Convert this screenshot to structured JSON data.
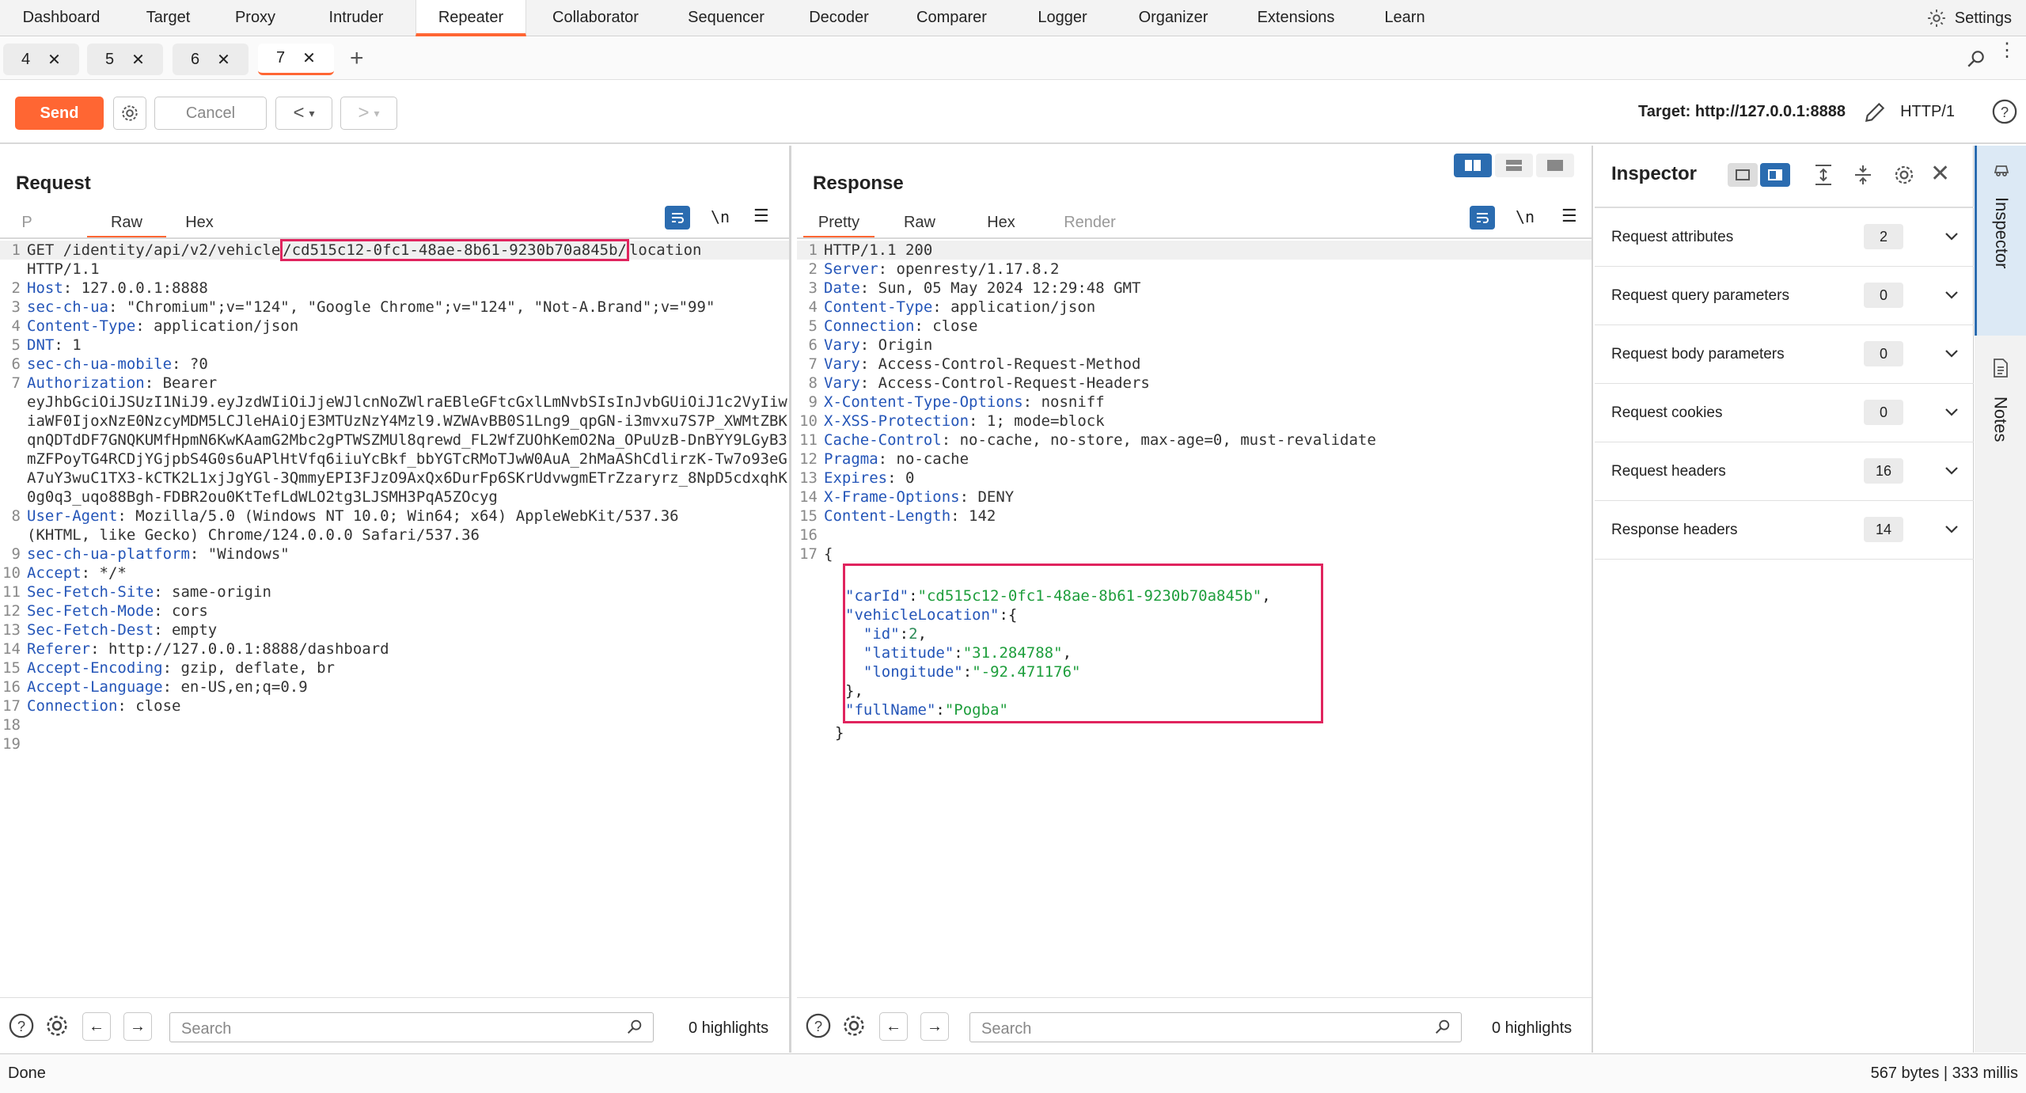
{
  "topnav": {
    "tabs": [
      "Dashboard",
      "Target",
      "Proxy",
      "Intruder",
      "Repeater",
      "Collaborator",
      "Sequencer",
      "Decoder",
      "Comparer",
      "Logger",
      "Organizer",
      "Extensions",
      "Learn"
    ],
    "active": "Repeater",
    "settings_label": "Settings"
  },
  "repeater_tabs": [
    "4",
    "5",
    "6",
    "7"
  ],
  "active_tab": "7",
  "toolbar": {
    "send_label": "Send",
    "cancel_label": "Cancel",
    "target_label": "Target: http://127.0.0.1:8888",
    "protocol_label": "HTTP/1"
  },
  "request": {
    "title": "Request",
    "view_tabs": [
      "P",
      "Raw",
      "Hex"
    ],
    "active_view": "Raw",
    "wrap_label": "\\n",
    "lines": [
      {
        "n": "1",
        "pre": "GET /identity/api/v2/vehicle",
        "hl": "/cd515c12-0fc1-48ae-8b61-9230b70a845b/",
        "post": "location"
      },
      {
        "n": "",
        "text": "HTTP/1.1"
      },
      {
        "n": "2",
        "key": "Host",
        "val": " 127.0.0.1:8888"
      },
      {
        "n": "3",
        "key": "sec-ch-ua",
        "val": " \"Chromium\";v=\"124\", \"Google Chrome\";v=\"124\", \"Not-A.Brand\";v=\"99\""
      },
      {
        "n": "4",
        "key": "Content-Type",
        "val": " application/json"
      },
      {
        "n": "5",
        "key": "DNT",
        "val": " 1"
      },
      {
        "n": "6",
        "key": "sec-ch-ua-mobile",
        "val": " ?0"
      },
      {
        "n": "7",
        "key": "Authorization",
        "val": " Bearer"
      },
      {
        "n": "",
        "text": "eyJhbGciOiJSUzI1NiJ9.eyJzdWIiOiJjeWJlcnNoZWlraEBleGFtcGxlLmNvbSIsInJvbGUiOiJ1c2VyIiwiaWF0IjoxNzE0NzcyMDM5LCJleHAiOjE3MTUzNzY4Mzl9.WZWAvBB0S1Lng9_qpGN-i3mvxu7S7P_XWMtZBKqnQDTdDF7GNQKUMfHpmN6KwKAamG2Mbc2gPTWSZMUl8qrewd_FL2WfZUOhKemO2Na_OPuUzB-DnBYY9LGyB3mZFPoyTG4RCDjYGjpbS4G0s6uAPlHtVfq6iiuYcBkf_bbYGTcRMoTJwW0AuA_2hMaAShCdlirzK-Tw7o93eGA7uY3wuC1TX3-kCTK2L1xjJgYGl-3QmmyEPI3FJzO9AxQx6DurFp6SKrUdvwgmETrZzaryrz_8NpD5cdxqhK0g0q3_uqo88Bgh-FDBR2ou0KtTefLdWLO2tg3LJSMH3PqA5ZOcyg"
      },
      {
        "n": "8",
        "key": "User-Agent",
        "val": " Mozilla/5.0 (Windows NT 10.0; Win64; x64) AppleWebKit/537.36"
      },
      {
        "n": "",
        "text": "(KHTML, like Gecko) Chrome/124.0.0.0 Safari/537.36"
      },
      {
        "n": "9",
        "key": "sec-ch-ua-platform",
        "val": " \"Windows\""
      },
      {
        "n": "10",
        "key": "Accept",
        "val": " */*"
      },
      {
        "n": "11",
        "key": "Sec-Fetch-Site",
        "val": " same-origin"
      },
      {
        "n": "12",
        "key": "Sec-Fetch-Mode",
        "val": " cors"
      },
      {
        "n": "13",
        "key": "Sec-Fetch-Dest",
        "val": " empty"
      },
      {
        "n": "14",
        "key": "Referer",
        "val": " http://127.0.0.1:8888/dashboard"
      },
      {
        "n": "15",
        "key": "Accept-Encoding",
        "val": " gzip, deflate, br"
      },
      {
        "n": "16",
        "key": "Accept-Language",
        "val": " en-US,en;q=0.9"
      },
      {
        "n": "17",
        "key": "Connection",
        "val": " close"
      },
      {
        "n": "18",
        "text": ""
      },
      {
        "n": "19",
        "text": ""
      }
    ],
    "search_placeholder": "Search",
    "highlights": "0 highlights"
  },
  "response": {
    "title": "Response",
    "view_tabs": [
      "Pretty",
      "Raw",
      "Hex",
      "Render"
    ],
    "active_view": "Pretty",
    "wrap_label": "\\n",
    "lines": [
      {
        "n": "1",
        "text": "HTTP/1.1 200"
      },
      {
        "n": "2",
        "key": "Server",
        "val": " openresty/1.17.8.2"
      },
      {
        "n": "3",
        "key": "Date",
        "val": " Sun, 05 May 2024 12:29:48 GMT"
      },
      {
        "n": "4",
        "key": "Content-Type",
        "val": " application/json"
      },
      {
        "n": "5",
        "key": "Connection",
        "val": " close"
      },
      {
        "n": "6",
        "key": "Vary",
        "val": " Origin"
      },
      {
        "n": "7",
        "key": "Vary",
        "val": " Access-Control-Request-Method"
      },
      {
        "n": "8",
        "key": "Vary",
        "val": " Access-Control-Request-Headers"
      },
      {
        "n": "9",
        "key": "X-Content-Type-Options",
        "val": " nosniff"
      },
      {
        "n": "10",
        "key": "X-XSS-Protection",
        "val": " 1; mode=block"
      },
      {
        "n": "11",
        "key": "Cache-Control",
        "val": " no-cache, no-store, max-age=0, must-revalidate"
      },
      {
        "n": "12",
        "key": "Pragma",
        "val": " no-cache"
      },
      {
        "n": "13",
        "key": "Expires",
        "val": " 0"
      },
      {
        "n": "14",
        "key": "X-Frame-Options",
        "val": " DENY"
      },
      {
        "n": "15",
        "key": "Content-Length",
        "val": " 142"
      },
      {
        "n": "16",
        "text": ""
      },
      {
        "n": "17",
        "text": "{"
      }
    ],
    "json": {
      "carId_key": "\"carId\"",
      "carId_val": "\"cd515c12-0fc1-48ae-8b61-9230b70a845b\"",
      "vl_key": "\"vehicleLocation\"",
      "id_key": "\"id\"",
      "id_val": "2",
      "lat_key": "\"latitude\"",
      "lat_val": "\"31.284788\"",
      "lon_key": "\"longitude\"",
      "lon_val": "\"-92.471176\"",
      "fn_key": "\"fullName\"",
      "fn_val": "\"Pogba\""
    },
    "search_placeholder": "Search",
    "highlights": "0 highlights"
  },
  "inspector": {
    "title": "Inspector",
    "rows": [
      {
        "label": "Request attributes",
        "count": "2"
      },
      {
        "label": "Request query parameters",
        "count": "0"
      },
      {
        "label": "Request body parameters",
        "count": "0"
      },
      {
        "label": "Request cookies",
        "count": "0"
      },
      {
        "label": "Request headers",
        "count": "16"
      },
      {
        "label": "Response headers",
        "count": "14"
      }
    ]
  },
  "sidebar": {
    "inspector_label": "Inspector",
    "notes_label": "Notes"
  },
  "status": {
    "left": "Done",
    "right": "567 bytes | 333 millis"
  },
  "colors": {
    "accent": "#ff6633",
    "header_key": "#2455b8",
    "json_string": "#1e9e3c",
    "highlight_box": "#e0245e",
    "blue_button": "#2b6cb0"
  }
}
